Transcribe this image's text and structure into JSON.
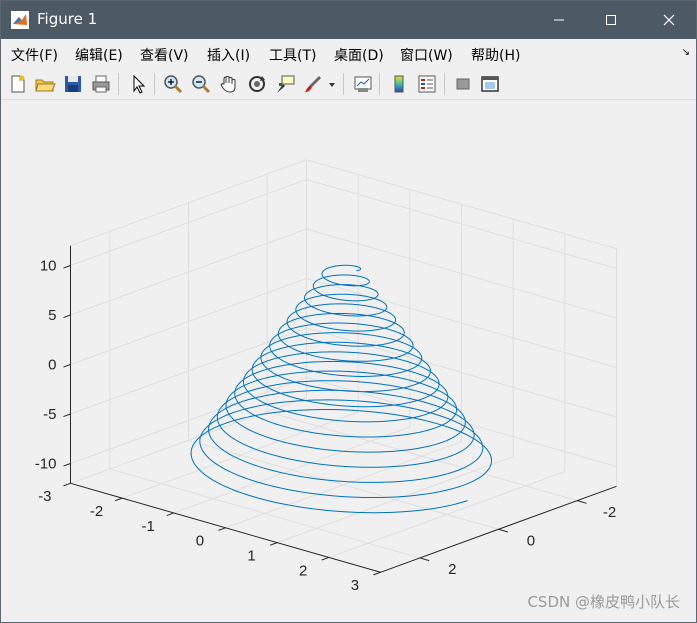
{
  "window": {
    "title": "Figure 1"
  },
  "menu": [
    "文件(F)",
    "编辑(E)",
    "查看(V)",
    "插入(I)",
    "工具(T)",
    "桌面(D)",
    "窗口(W)",
    "帮助(H)"
  ],
  "toolbar": [
    "new-figure",
    "open-file",
    "save",
    "print",
    "select-arrow",
    "zoom-in",
    "zoom-out",
    "pan-hand",
    "rotate-3d",
    "data-cursor",
    "brush",
    "brush-dropdown",
    "link-plot",
    "insert-colorbar",
    "insert-legend",
    "hide-plot-tools",
    "show-plot-tools"
  ],
  "chart_data": {
    "type": "line",
    "mode": "3d",
    "description_formula": "x = 0.2*t*sin(t) style conical helix",
    "series": [
      {
        "color": "#0072bd",
        "turns": 16,
        "z_range": [
          -10,
          10
        ],
        "radius_at_bottom": 2.4,
        "radius_at_top": 0.25
      }
    ],
    "x_ticks": [
      -3,
      -2,
      -1,
      0,
      1,
      2,
      3
    ],
    "y_ticks": [
      -2,
      0,
      2
    ],
    "z_ticks": [
      10,
      5,
      0,
      -5,
      -10
    ],
    "xlim": [
      -3,
      3
    ],
    "ylim": [
      -3,
      3
    ],
    "zlim": [
      -12,
      12
    ],
    "grid": true
  },
  "watermark": "CSDN @橡皮鸭小队长"
}
